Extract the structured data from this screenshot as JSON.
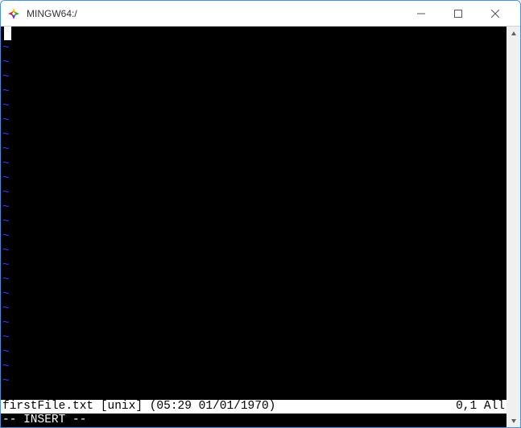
{
  "window": {
    "title": "MINGW64:/"
  },
  "editor": {
    "tilde_char": "~",
    "tilde_count": 24,
    "status": {
      "left": "firstFile.txt [unix] (05:29 01/01/1970)",
      "right": "0,1 All"
    },
    "mode": "-- INSERT --"
  }
}
